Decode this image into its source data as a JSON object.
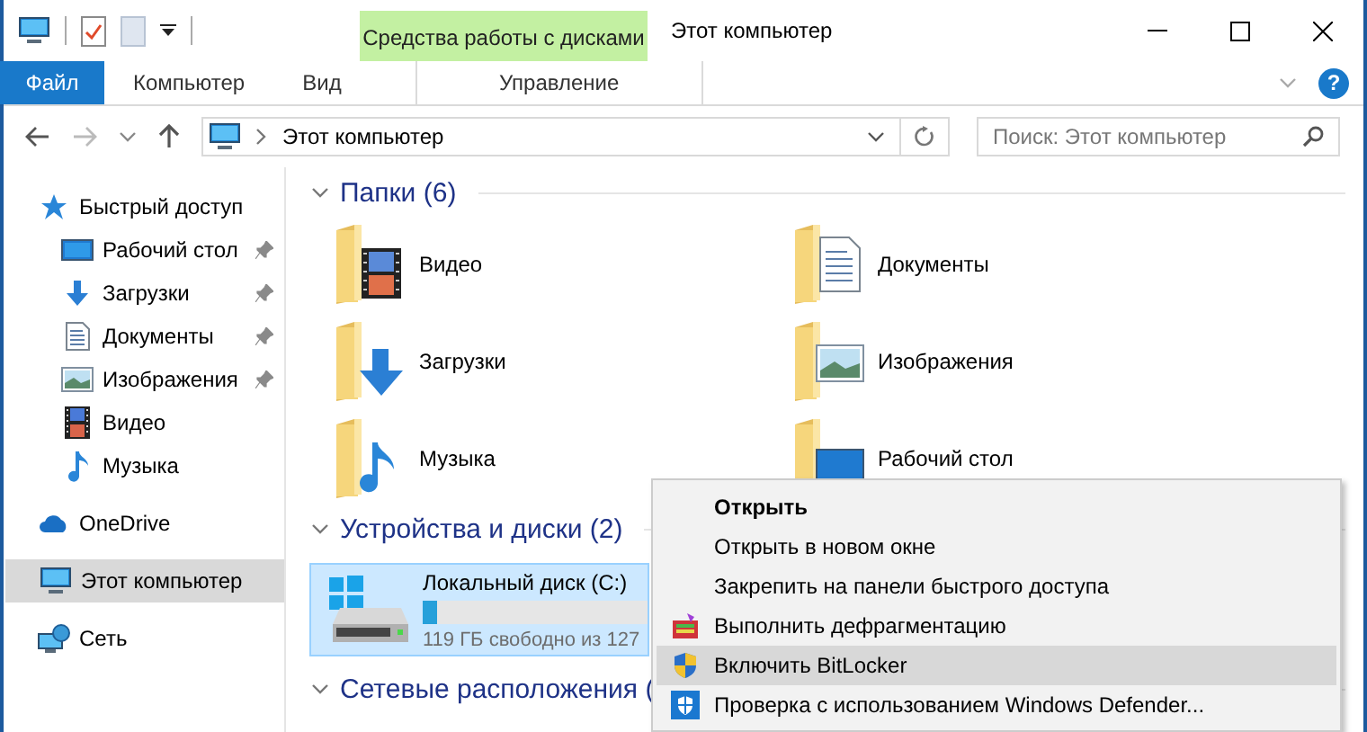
{
  "window": {
    "title": "Этот компьютер"
  },
  "ribbon": {
    "contextual_group": "Средства работы с дисками",
    "help": "?",
    "tabs": [
      {
        "label": "Файл",
        "kind": "file"
      },
      {
        "label": "Компьютер",
        "kind": "tab"
      },
      {
        "label": "Вид",
        "kind": "tab"
      },
      {
        "label": "Управление",
        "kind": "contextual"
      }
    ]
  },
  "navigation": {
    "back_enabled": true,
    "forward_enabled": false
  },
  "address_bar": {
    "path": "Этот компьютер"
  },
  "search": {
    "placeholder": "Поиск: Этот компьютер"
  },
  "sidebar": {
    "items": [
      {
        "label": "Быстрый доступ",
        "kind": "quick",
        "selected": false,
        "children": [
          {
            "label": "Рабочий стол",
            "kind": "desktop",
            "pinned": true,
            "selected": false
          },
          {
            "label": "Загрузки",
            "kind": "downloads",
            "pinned": true,
            "selected": false
          },
          {
            "label": "Документы",
            "kind": "documents",
            "pinned": true,
            "selected": false
          },
          {
            "label": "Изображения",
            "kind": "pictures",
            "pinned": true,
            "selected": false
          },
          {
            "label": "Видео",
            "kind": "video",
            "pinned": false,
            "selected": false
          },
          {
            "label": "Музыка",
            "kind": "music",
            "pinned": false,
            "selected": false
          }
        ]
      },
      {
        "label": "OneDrive",
        "kind": "cloud",
        "selected": false
      },
      {
        "label": "Этот компьютер",
        "kind": "pc",
        "selected": true
      },
      {
        "label": "Сеть",
        "kind": "network",
        "selected": false
      }
    ]
  },
  "sections": [
    {
      "title": "Папки (6)",
      "kind": "folders",
      "expanded": true,
      "items": [
        {
          "label": "Видео",
          "kind": "video"
        },
        {
          "label": "Документы",
          "kind": "documents"
        },
        {
          "label": "Загрузки",
          "kind": "downloads"
        },
        {
          "label": "Изображения",
          "kind": "pictures"
        },
        {
          "label": "Музыка",
          "kind": "music"
        },
        {
          "label": "Рабочий стол",
          "kind": "desktop"
        }
      ]
    },
    {
      "title": "Устройства и диски (2)",
      "kind": "drives",
      "expanded": true,
      "items": [
        {
          "label": "Локальный диск (C:)",
          "level": 0.063,
          "free": "119 ГБ свободно из 127",
          "selected": true
        }
      ]
    },
    {
      "title": "Сетевые расположения (",
      "kind": "network",
      "expanded": true
    }
  ],
  "context_menu": {
    "items": [
      {
        "label": "Открыть",
        "kind": "default",
        "selected": false
      },
      {
        "label": "Открыть в новом окне",
        "kind": "plain",
        "selected": false
      },
      {
        "label": "Закрепить на панели быстрого доступа",
        "kind": "plain",
        "selected": false
      },
      {
        "label": "Выполнить дефрагментацию",
        "kind": "defrag",
        "selected": false
      },
      {
        "label": "Включить BitLocker",
        "kind": "shield",
        "selected": true
      },
      {
        "label": "Проверка с использованием Windows Defender...",
        "kind": "defender",
        "selected": false
      }
    ]
  }
}
